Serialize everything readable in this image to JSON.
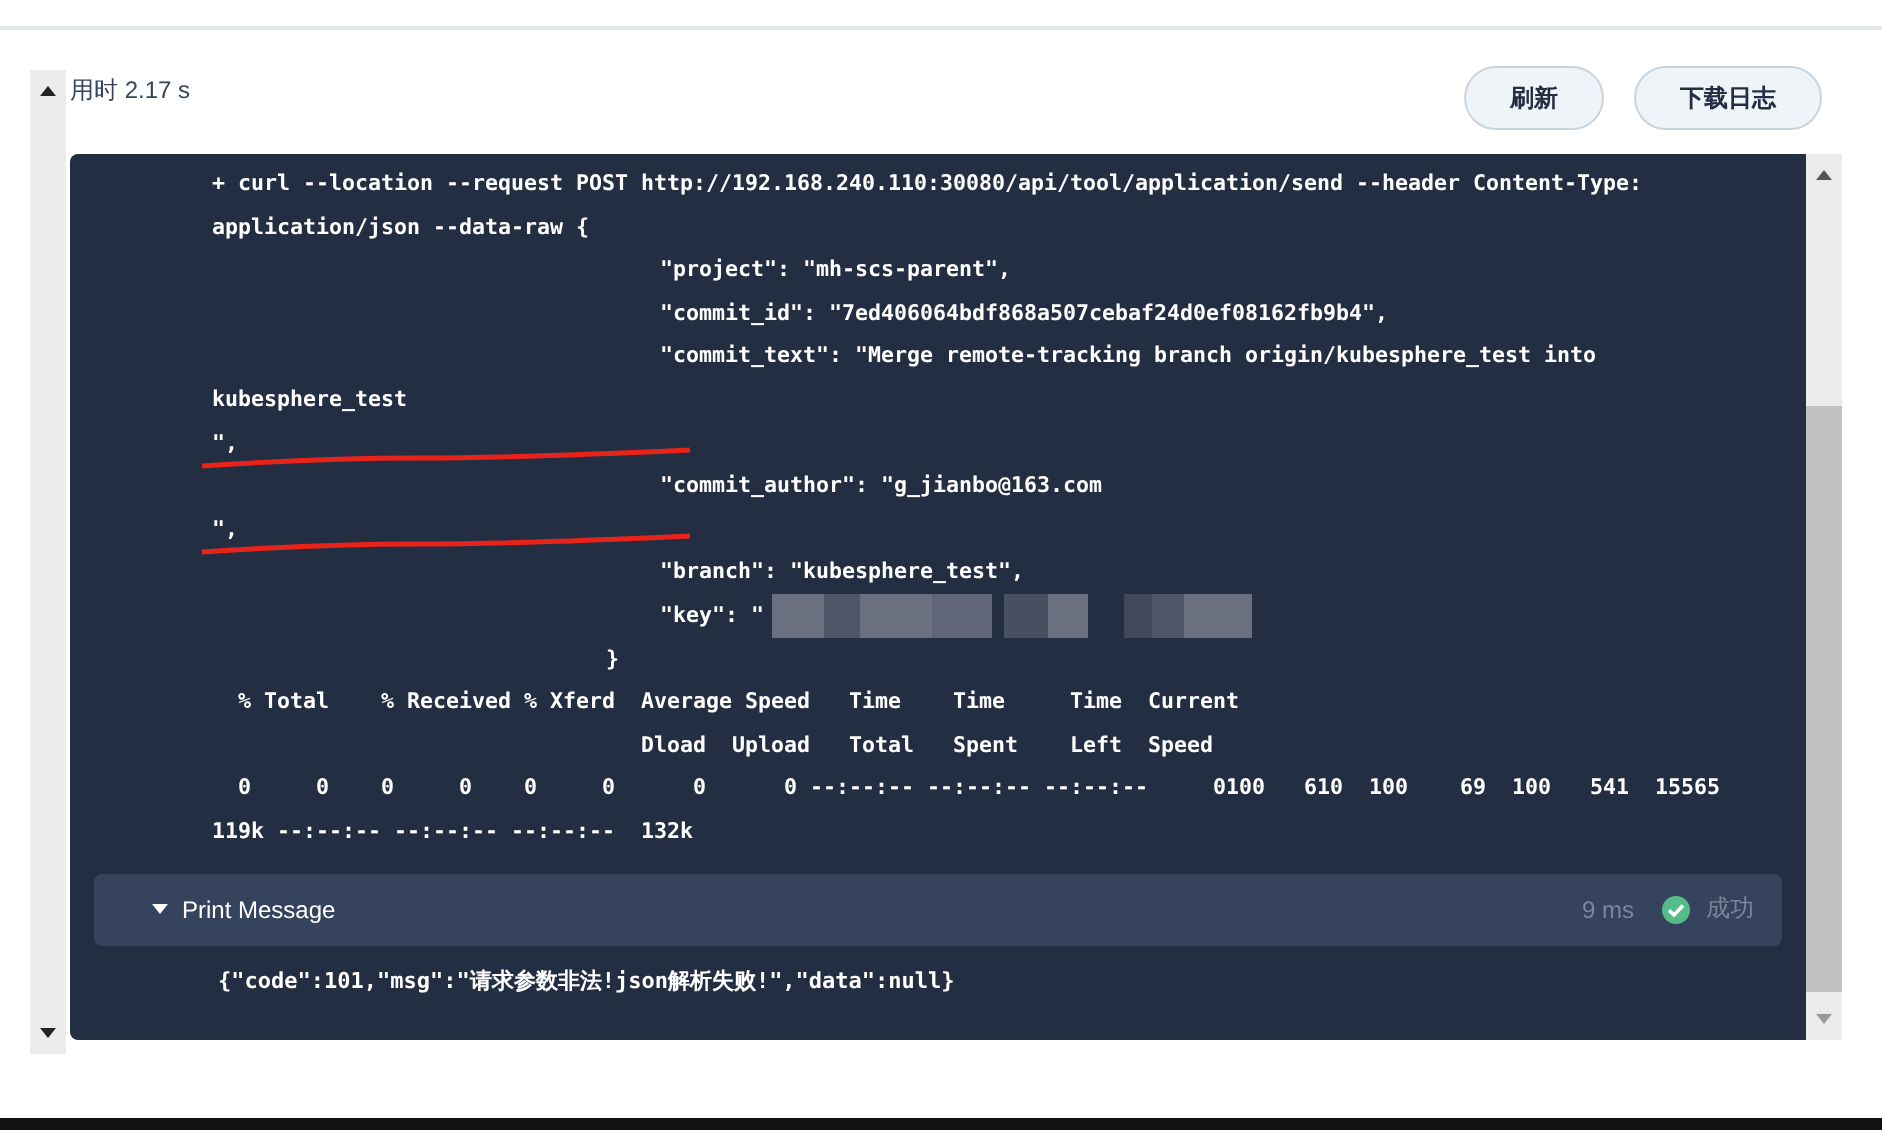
{
  "header": {
    "duration": "用时 2.17 s",
    "buttons": [
      "刷新",
      "下载日志"
    ]
  },
  "log_lines": [
    {
      "kind": "base",
      "text": "+ curl --location --request POST http://192.168.240.110:30080/api/tool/application/send --header Content-Type:",
      "underlined": false
    },
    {
      "kind": "base",
      "text": "application/json --data-raw {",
      "underlined": false
    },
    {
      "kind": "deep",
      "text": "\"project\": \"mh-scs-parent\",",
      "underlined": false
    },
    {
      "kind": "deep",
      "text": "\"commit_id\": \"7ed406064bdf868a507cebaf24d0ef08162fb9b4\",",
      "underlined": false
    },
    {
      "kind": "deep",
      "text": "\"commit_text\": \"Merge remote-tracking branch origin/kubesphere_test into",
      "underlined": false
    },
    {
      "kind": "base",
      "text": "kubesphere_test",
      "underlined": false
    },
    {
      "kind": "base",
      "text": "\",",
      "underlined": true
    },
    {
      "kind": "deep",
      "text": "\"commit_author\": \"g_jianbo@163.com",
      "underlined": false
    },
    {
      "kind": "base",
      "text": "\",",
      "underlined": true
    },
    {
      "kind": "deep",
      "text": "\"branch\": \"kubesphere_test\",",
      "underlined": false
    },
    {
      "kind": "redacted",
      "text": "\"key\": \"",
      "underlined": false
    },
    {
      "kind": "close",
      "text": "}",
      "underlined": false
    },
    {
      "kind": "base",
      "text": "  % Total    % Received % Xferd  Average Speed   Time    Time     Time  Current",
      "underlined": false
    },
    {
      "kind": "base",
      "text": "                                 Dload  Upload   Total   Spent    Left  Speed",
      "underlined": false
    },
    {
      "kind": "base",
      "text": "  0     0    0     0    0     0      0      0 --:--:-- --:--:-- --:--:--     0100   610  100    69  100   541  15565",
      "underlined": false
    },
    {
      "kind": "base",
      "text": "119k --:--:-- --:--:-- --:--:--  132k",
      "underlined": false
    }
  ],
  "step": {
    "title": "Print Message",
    "expanded": true,
    "time": "9 ms",
    "success": true,
    "status": "成功",
    "output": "{\"code\":101,\"msg\":\"请求参数非法!json解析失败!\",\"data\":null}"
  }
}
